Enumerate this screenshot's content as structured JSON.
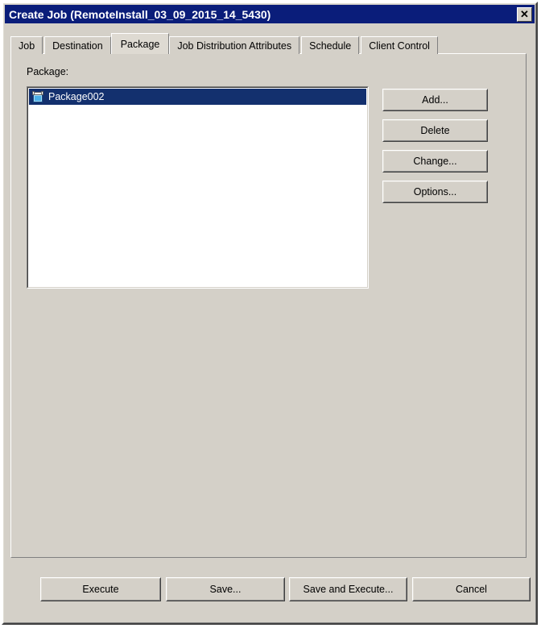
{
  "window": {
    "title": "Create Job (RemoteInstall_03_09_2015_14_5430)",
    "close_label": "✕",
    "close_icon": "close-icon",
    "titlebar_color": "#0a1d7a",
    "face_color": "#d4d0c8"
  },
  "tabs": [
    {
      "label": "Job",
      "active": false
    },
    {
      "label": "Destination",
      "active": false
    },
    {
      "label": "Package",
      "active": true
    },
    {
      "label": "Job Distribution Attributes",
      "active": false
    },
    {
      "label": "Schedule",
      "active": false
    },
    {
      "label": "Client Control",
      "active": false
    }
  ],
  "package_panel": {
    "label": "Package:",
    "list_items": [
      {
        "label": "Package002",
        "icon": "package-box-icon",
        "selected": true,
        "selection_color": "#13306e"
      }
    ],
    "buttons": [
      {
        "id": "add",
        "label": "Add..."
      },
      {
        "id": "delete",
        "label": "Delete"
      },
      {
        "id": "change",
        "label": "Change..."
      },
      {
        "id": "options",
        "label": "Options..."
      }
    ]
  },
  "footer": {
    "buttons": [
      {
        "id": "execute",
        "label": "Execute"
      },
      {
        "id": "save",
        "label": "Save..."
      },
      {
        "id": "save_execute",
        "label": "Save and Execute..."
      },
      {
        "id": "cancel",
        "label": "Cancel"
      }
    ]
  }
}
